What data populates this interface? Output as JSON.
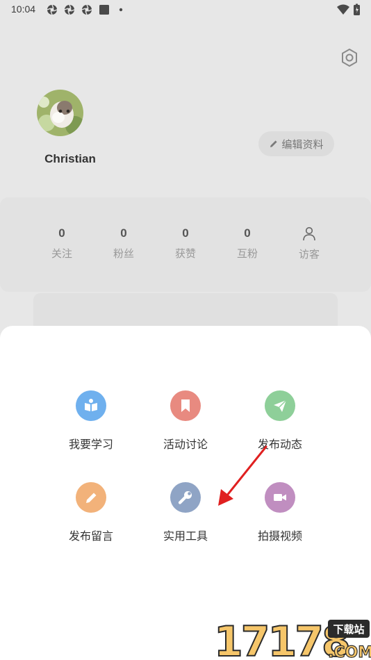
{
  "status_bar": {
    "time": "10:04"
  },
  "profile": {
    "username": "Christian",
    "edit_label": "编辑资料"
  },
  "stats": [
    {
      "value": "0",
      "label": "关注"
    },
    {
      "value": "0",
      "label": "粉丝"
    },
    {
      "value": "0",
      "label": "获赞"
    },
    {
      "value": "0",
      "label": "互粉"
    },
    {
      "value": "",
      "label": "访客",
      "icon": "person-icon"
    }
  ],
  "menu": [
    {
      "label": "我要学习",
      "icon": "book-icon",
      "color": "#6fb0ee"
    },
    {
      "label": "活动讨论",
      "icon": "bookmark-icon",
      "color": "#e88a80"
    },
    {
      "label": "发布动态",
      "icon": "paper-plane-icon",
      "color": "#8ecf99"
    },
    {
      "label": "发布留言",
      "icon": "pencil-icon",
      "color": "#f2b27a"
    },
    {
      "label": "实用工具",
      "icon": "wrench-icon",
      "color": "#8fa4c5"
    },
    {
      "label": "拍摄视频",
      "icon": "video-camera-icon",
      "color": "#c08ec0"
    }
  ],
  "watermark": {
    "number": "17178",
    "badge": "下载站",
    "domain": ".COM"
  },
  "colors": {
    "annotation_arrow": "#e02020"
  }
}
